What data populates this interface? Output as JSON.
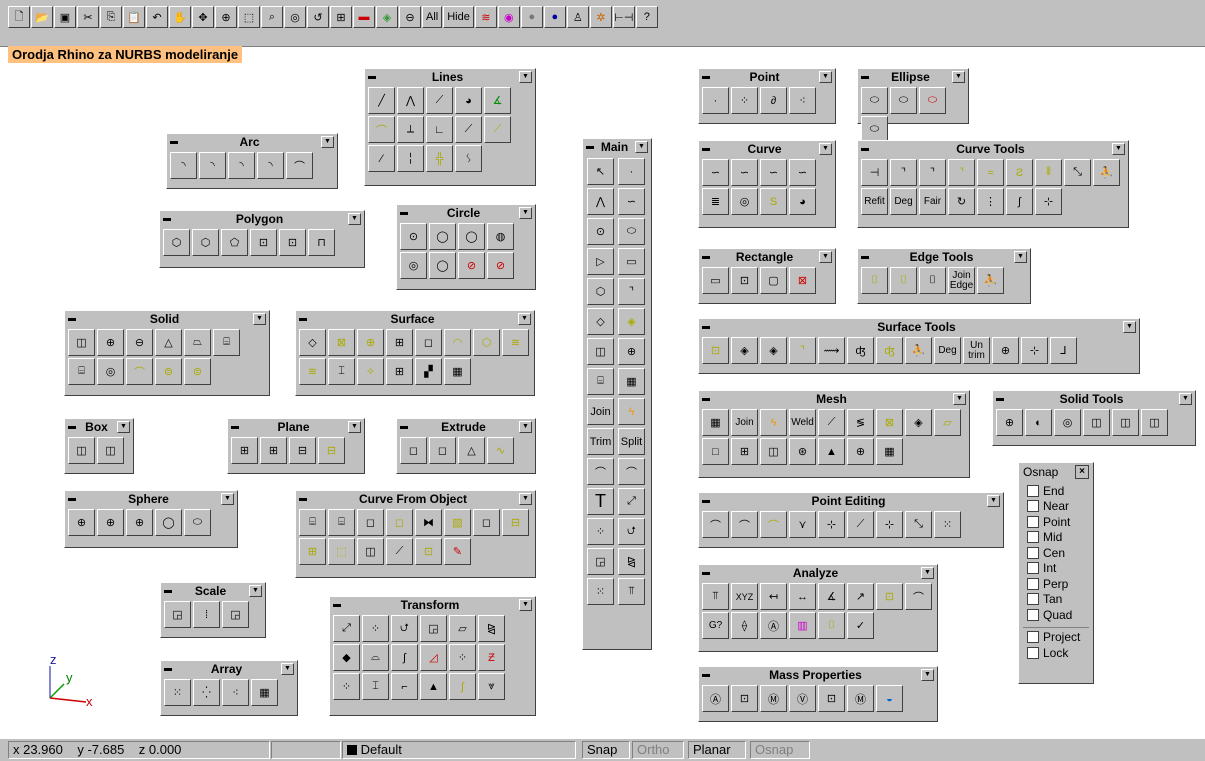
{
  "toolbar": {
    "all_label": "All",
    "hide_label": "Hide"
  },
  "title": "Orodja Rhino za NURBS modeliranje",
  "panels": {
    "lines": "Lines",
    "arc": "Arc",
    "polygon": "Polygon",
    "circle": "Circle",
    "solid": "Solid",
    "surface": "Surface",
    "box": "Box",
    "plane": "Plane",
    "extrude": "Extrude",
    "sphere": "Sphere",
    "curve_from_object": "Curve From Object",
    "scale": "Scale",
    "transform": "Transform",
    "array": "Array",
    "main": "Main",
    "point": "Point",
    "ellipse": "Ellipse",
    "curve": "Curve",
    "curve_tools": "Curve Tools",
    "rectangle": "Rectangle",
    "edge_tools": "Edge Tools",
    "surface_tools": "Surface Tools",
    "mesh": "Mesh",
    "solid_tools": "Solid Tools",
    "point_editing": "Point Editing",
    "analyze": "Analyze",
    "mass_properties": "Mass Properties"
  },
  "buttons": {
    "join": "Join",
    "split": "Split",
    "trim": "Trim",
    "t": "T",
    "refit": "Refit",
    "deg": "Deg",
    "fair": "Fair",
    "join_edge": "Join Edge",
    "deg2": "Deg",
    "untrim": "Un trim",
    "mesh_join": "Join",
    "weld": "Weld",
    "xyz": "XYZ",
    "g2": "G?"
  },
  "osnap": {
    "title": "Osnap",
    "items": [
      "End",
      "Near",
      "Point",
      "Mid",
      "Cen",
      "Int",
      "Perp",
      "Tan",
      "Quad"
    ],
    "extra": [
      "Project",
      "Lock"
    ]
  },
  "axis": {
    "z": "z",
    "y": "y",
    "x": "x"
  },
  "status": {
    "x": "x  23.960",
    "y": "y  -7.685",
    "z": "z  0.000",
    "layer": "Default",
    "snap": "Snap",
    "ortho": "Ortho",
    "planar": "Planar",
    "osnap": "Osnap"
  },
  "colors": {
    "title_bg": "#ffc080",
    "face": "#c0c0c0",
    "accent": "#ffff00"
  }
}
